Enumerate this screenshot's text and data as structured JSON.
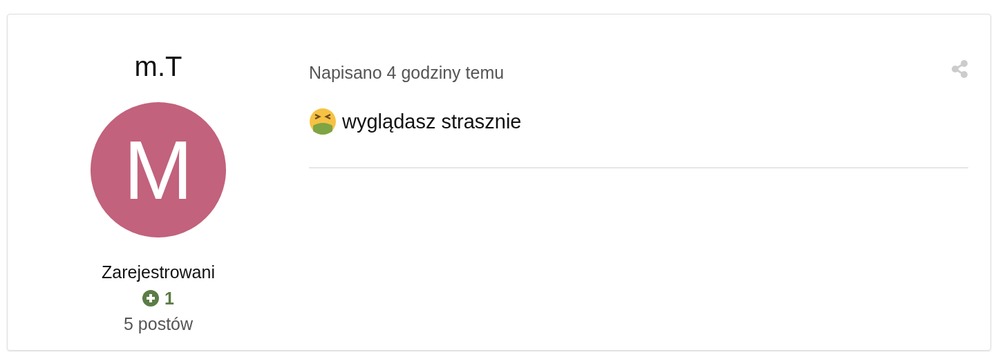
{
  "author": {
    "name": "m.T",
    "avatar_letter": "M",
    "group": "Zarejestrowani",
    "reputation": "1",
    "posts": "5 postów"
  },
  "post": {
    "date": "Napisano 4 godziny temu",
    "text": "wyglądasz strasznie"
  }
}
